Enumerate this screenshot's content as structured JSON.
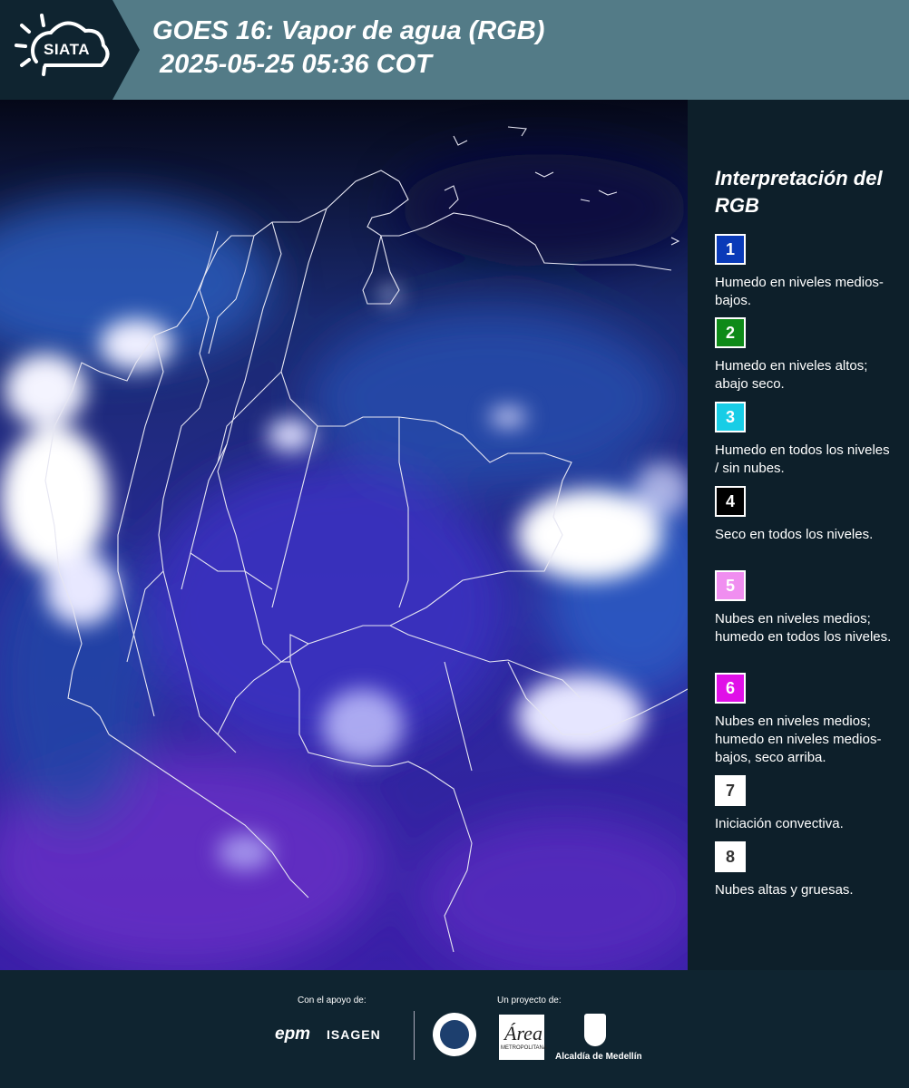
{
  "header": {
    "logo_text": "SIATA",
    "title_line1": "GOES 16: Vapor de agua (RGB)",
    "title_line2": " 2025-05-25 05:36 COT"
  },
  "legend": {
    "title": "Interpretación del RGB",
    "items": [
      {
        "num": "1",
        "color": "#0a3ab8",
        "text": "Humedo en niveles medios-bajos."
      },
      {
        "num": "2",
        "color": "#0e8a18",
        "text": "Humedo en niveles altos; abajo seco."
      },
      {
        "num": "3",
        "color": "#18cde6",
        "text": "Humedo en todos los niveles / sin nubes."
      },
      {
        "num": "4",
        "color": "#000000",
        "text": "Seco en todos los niveles."
      },
      {
        "num": "5",
        "color": "#f08ef0",
        "text": "Nubes en niveles medios; humedo en todos los niveles."
      },
      {
        "num": "6",
        "color": "#e010e8",
        "text": "Nubes en niveles medios; humedo en niveles medios-bajos, seco arriba."
      },
      {
        "num": "7",
        "color": "#ffffff",
        "text": "Iniciación convectiva."
      },
      {
        "num": "8",
        "color": "#ffffff",
        "text": "Nubes altas y gruesas."
      }
    ]
  },
  "footer": {
    "support_label": "Con el apoyo de:",
    "project_label": "Un proyecto de:",
    "epm": "epm",
    "isagen": "ISAGEN",
    "area_text": "Área",
    "area_sub": "METROPOLITANA",
    "alcaldia": "Alcaldía de Medellín"
  }
}
